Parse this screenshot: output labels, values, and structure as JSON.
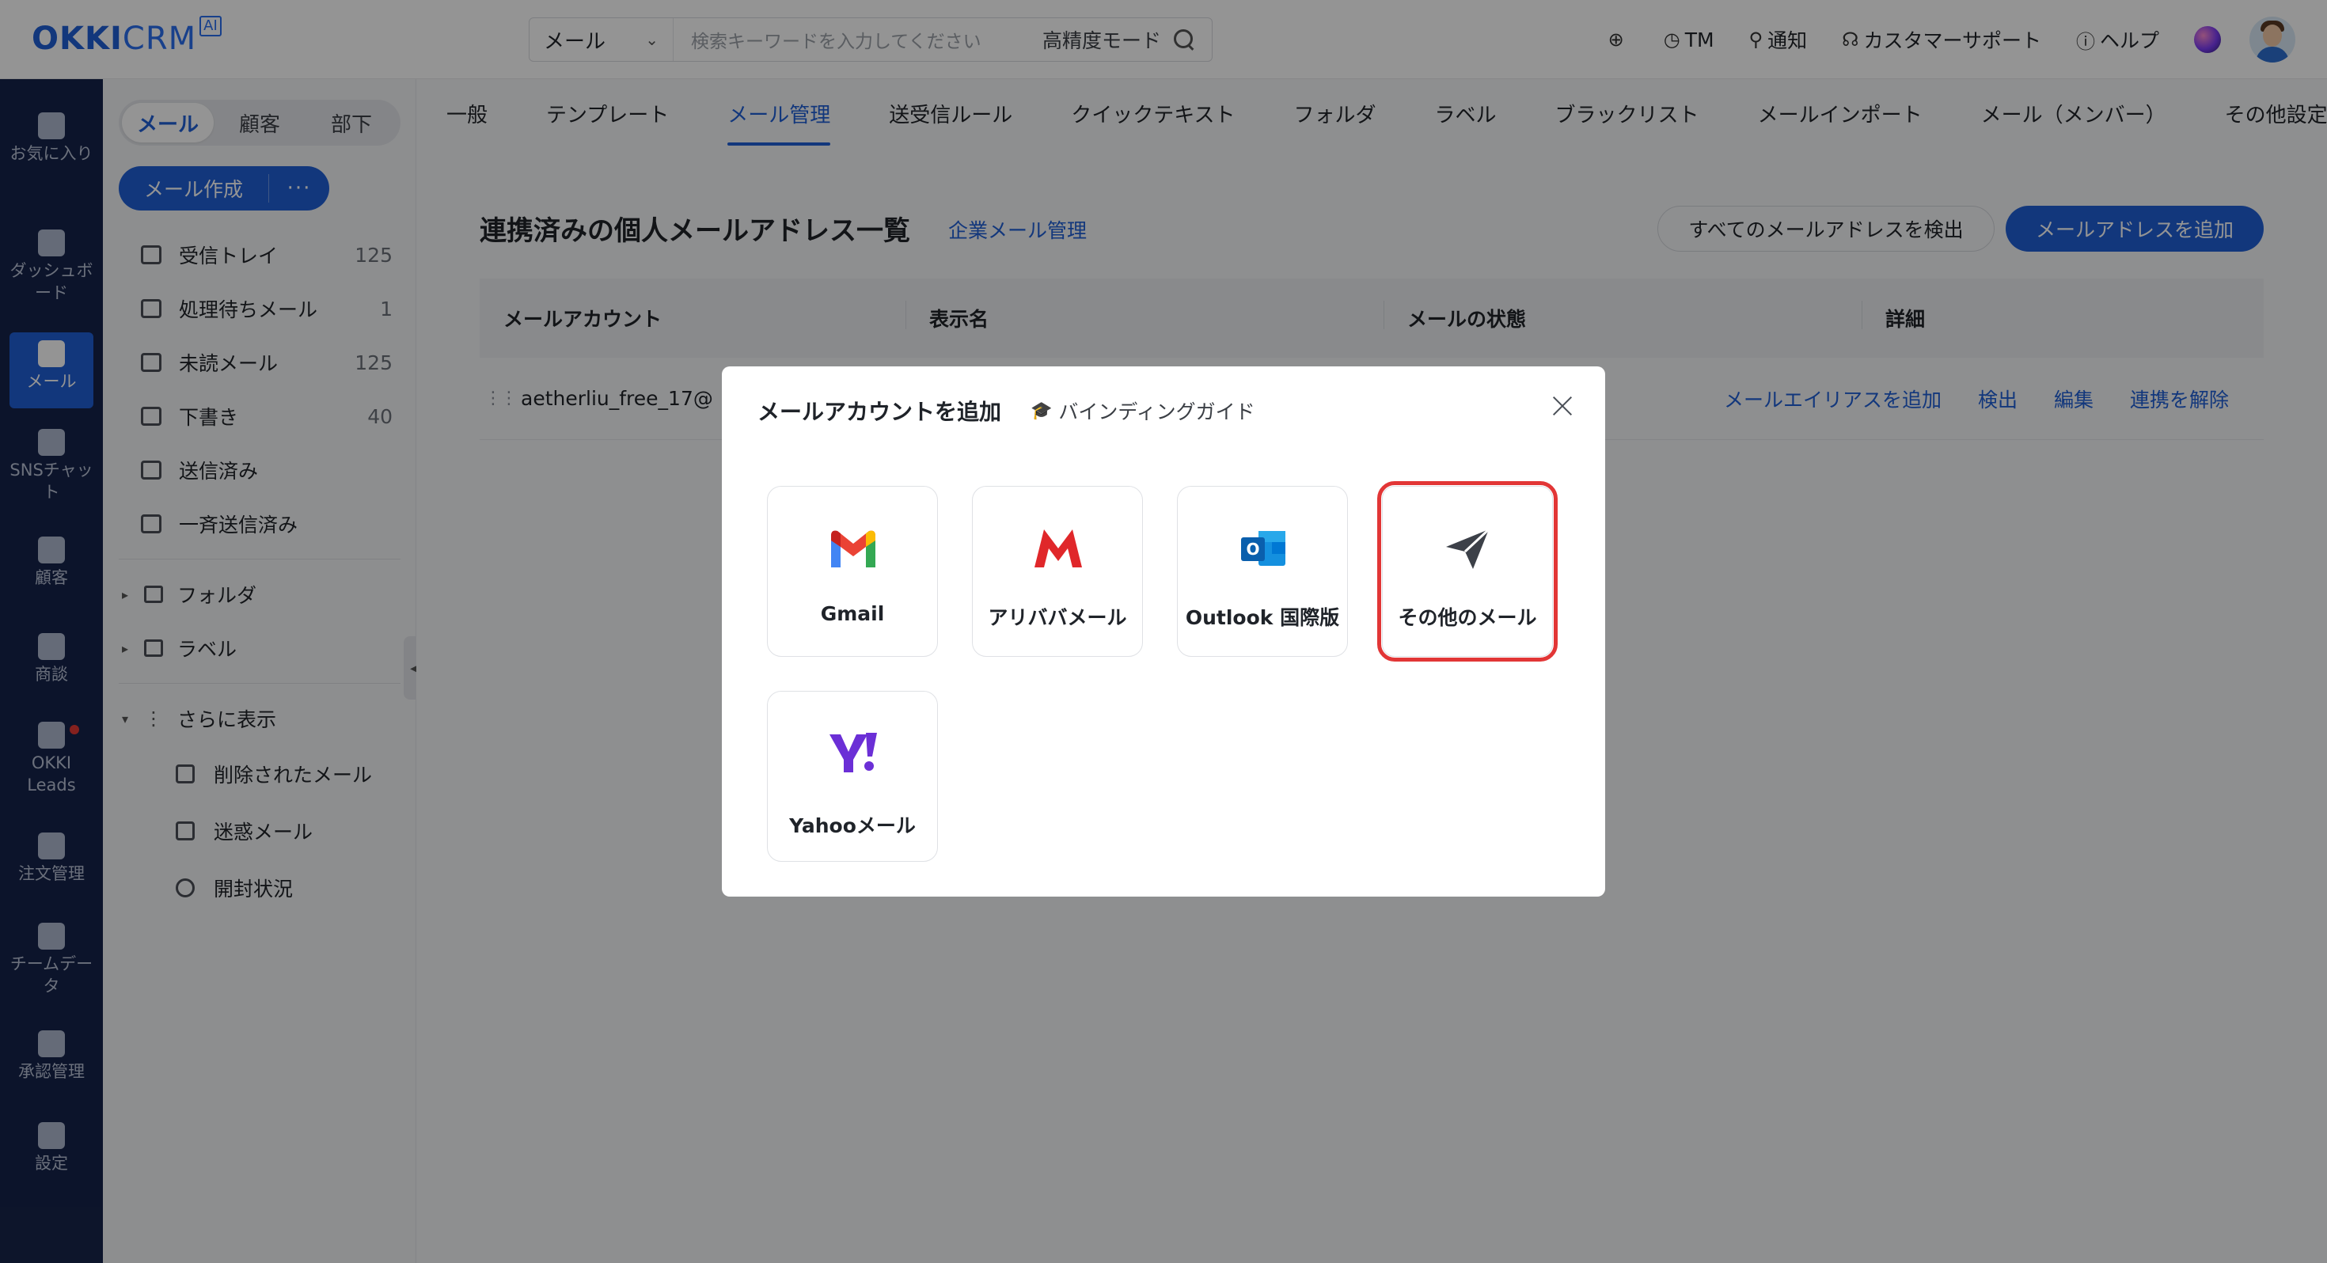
{
  "header": {
    "logo_brand": "OKKI",
    "logo_crm": "CRM",
    "logo_ai": "AI",
    "search_scope": "メール",
    "search_placeholder": "検索キーワードを入力してください",
    "search_mode": "高精度モード",
    "items": [
      {
        "icon": "plus-circle-icon",
        "label": ""
      },
      {
        "icon": "clock-icon",
        "label": "TM"
      },
      {
        "icon": "bell-icon",
        "label": "通知"
      },
      {
        "icon": "headset-icon",
        "label": "カスタマーサポート"
      },
      {
        "icon": "help-icon",
        "label": "ヘルプ"
      }
    ]
  },
  "rail": [
    {
      "label": "お気に入り",
      "icon": "star-icon"
    },
    {
      "label": "ダッシュボード",
      "icon": "dashboard-icon"
    },
    {
      "label": "メール",
      "icon": "mail-icon",
      "active": true
    },
    {
      "label": "SNSチャット",
      "icon": "chat-icon"
    },
    {
      "label": "顧客",
      "icon": "customers-icon"
    },
    {
      "label": "商談",
      "icon": "target-icon"
    },
    {
      "label": "OKKI Leads",
      "icon": "leads-icon",
      "badge": true
    },
    {
      "label": "注文管理",
      "icon": "order-icon"
    },
    {
      "label": "チームデータ",
      "icon": "chart-icon"
    },
    {
      "label": "承認管理",
      "icon": "approval-icon"
    },
    {
      "label": "設定",
      "icon": "settings-icon"
    }
  ],
  "sidebar": {
    "segments": [
      "メール",
      "顧客",
      "部下"
    ],
    "compose_label": "メール作成",
    "compose_more": "···",
    "folders": [
      {
        "label": "受信トレイ",
        "count": "125",
        "icon": "inbox-icon"
      },
      {
        "label": "処理待ちメール",
        "count": "1",
        "icon": "pending-icon"
      },
      {
        "label": "未読メール",
        "count": "125",
        "icon": "unread-icon"
      },
      {
        "label": "下書き",
        "count": "40",
        "icon": "draft-icon"
      },
      {
        "label": "送信済み",
        "count": "",
        "icon": "sent-icon"
      },
      {
        "label": "一斉送信済み",
        "count": "",
        "icon": "bulk-sent-icon"
      }
    ],
    "groups": [
      {
        "label": "フォルダ",
        "icon": "folder-icon"
      },
      {
        "label": "ラベル",
        "icon": "bookmark-icon"
      }
    ],
    "more_label": "さらに表示",
    "more_items": [
      {
        "label": "削除されたメール",
        "icon": "trash-icon"
      },
      {
        "label": "迷惑メール",
        "icon": "spam-icon"
      },
      {
        "label": "開封状況",
        "icon": "tracking-icon"
      }
    ]
  },
  "tabs": [
    {
      "label": "一般"
    },
    {
      "label": "テンプレート"
    },
    {
      "label": "メール管理",
      "active": true
    },
    {
      "label": "送受信ルール"
    },
    {
      "label": "クイックテキスト"
    },
    {
      "label": "フォルダ"
    },
    {
      "label": "ラベル"
    },
    {
      "label": "ブラックリスト"
    },
    {
      "label": "メールインポート"
    },
    {
      "label": "メール（メンバー）"
    },
    {
      "label": "その他設定"
    }
  ],
  "page": {
    "title": "連携済みの個人メールアドレス一覧",
    "title_link": "企業メール管理",
    "detect_all": "すべてのメールアドレスを検出",
    "add_address": "メールアドレスを追加",
    "columns": [
      "メールアカウント",
      "表示名",
      "メールの状態",
      "詳細"
    ],
    "rows": [
      {
        "account": "aetherliu_free_17@",
        "actions": [
          "メールエイリアスを追加",
          "検出",
          "編集",
          "連携を解除"
        ]
      }
    ]
  },
  "modal": {
    "title": "メールアカウントを追加",
    "guide": "バインディングガイド",
    "providers": [
      {
        "label": "Gmail",
        "icon": "gmail-icon"
      },
      {
        "label": "アリババメール",
        "icon": "alibaba-mail-icon"
      },
      {
        "label": "Outlook 国際版",
        "icon": "outlook-icon"
      },
      {
        "label": "その他のメール",
        "icon": "paper-plane-icon",
        "highlighted": true
      },
      {
        "label": "Yahooメール",
        "icon": "yahoo-icon"
      }
    ]
  }
}
